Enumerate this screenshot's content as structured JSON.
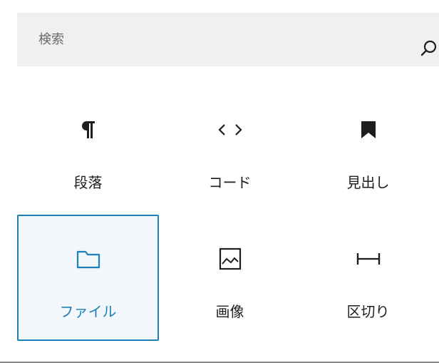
{
  "search": {
    "placeholder": "検索",
    "value": "",
    "icon": "search-icon"
  },
  "blocks": [
    {
      "label": "段落",
      "icon": "paragraph-icon",
      "selected": false
    },
    {
      "label": "コード",
      "icon": "code-icon",
      "selected": false
    },
    {
      "label": "見出し",
      "icon": "bookmark-icon",
      "selected": false
    },
    {
      "label": "ファイル",
      "icon": "folder-icon",
      "selected": true
    },
    {
      "label": "画像",
      "icon": "image-icon",
      "selected": false
    },
    {
      "label": "区切り",
      "icon": "separator-icon",
      "selected": false
    }
  ],
  "colors": {
    "accent": "#1f7fb8",
    "selected_bg": "#f1f7fb",
    "search_bg": "#f0f0f0",
    "text": "#1e1e1e"
  }
}
